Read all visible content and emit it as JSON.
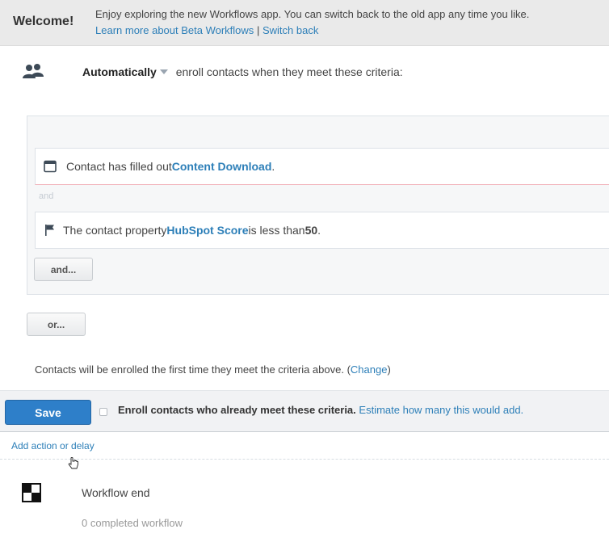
{
  "banner": {
    "welcome": "Welcome!",
    "message": "Enjoy exploring the new Workflows app. You can switch back to the old app any time you like.",
    "learn_more": "Learn more about Beta Workflows",
    "separator": "|",
    "switch_back": "Switch back"
  },
  "enrollment": {
    "mode": "Automatically",
    "text": "enroll contacts when they meet these criteria:"
  },
  "criteria": {
    "row1": {
      "prefix": "Contact has filled out ",
      "form": "Content Download",
      "suffix": "."
    },
    "and_separator": "and",
    "row2": {
      "prefix": "The contact property ",
      "property": "HubSpot Score",
      "middle": " is less than ",
      "value": "50",
      "suffix": "."
    },
    "and_button": "and...",
    "or_button": "or..."
  },
  "note": {
    "text": "Contacts will be enrolled the first time they meet the criteria above. (",
    "change": "Change",
    "close": ")"
  },
  "save_bar": {
    "save_label": "Save",
    "enroll_text": "Enroll contacts who already meet these criteria.",
    "estimate_link": "Estimate how many this would add."
  },
  "add_action": "Add action or delay",
  "workflow_end": {
    "title": "Workflow end",
    "count": "0 completed workflow"
  },
  "colors": {
    "accent": "#2d7fb8",
    "save_button": "#2e7fc9",
    "banner_bg": "#eaeaea"
  },
  "icons": {
    "enroll": "people-icon",
    "form": "form-icon",
    "property": "flag-icon",
    "end": "checkered-flag-icon"
  }
}
